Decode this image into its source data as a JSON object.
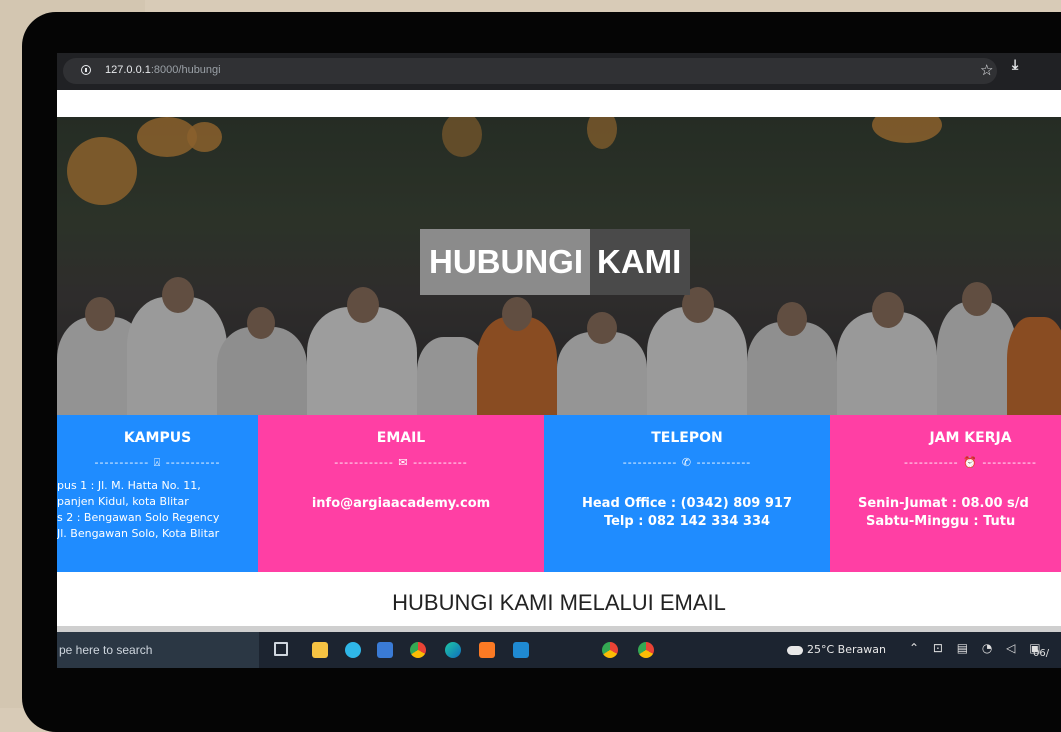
{
  "browser": {
    "url_host": "127.0.0.1",
    "url_path": ":8000/hubungi"
  },
  "hero": {
    "title_word1": "HUBUNGI",
    "title_word2": "KAMI"
  },
  "cards": [
    {
      "title": "KAMPUS",
      "separator": "----------- ⍓ -----------",
      "lines": [
        "pus 1 : Jl. M. Hatta No. 11,",
        "panjen Kidul, kota Blitar",
        "s 2 : Bengawan Solo Regency",
        "Jl. Bengawan Solo, Kota Blitar"
      ],
      "color": "#1f8cff"
    },
    {
      "title": "EMAIL",
      "separator": "------------ ✉ -----------",
      "lines": [
        "info@argiaacademy.com"
      ],
      "color": "#ff3fa4"
    },
    {
      "title": "TELEPON",
      "separator": "----------- ✆ -----------",
      "lines": [
        "Head Office : (0342) 809 917",
        "Telp : 082 142 334 334"
      ],
      "color": "#1f8cff"
    },
    {
      "title": "JAM KERJA",
      "separator": "----------- ⏰ -----------",
      "lines": [
        "Senin-Jumat : 08.00 s/d",
        "Sabtu-Minggu : Tutu"
      ],
      "color": "#ff3fa4"
    }
  ],
  "section": {
    "title": "HUBUNGI KAMI MELALUI EMAIL"
  },
  "taskbar": {
    "search_text": "pe here to search",
    "weather": "25°C  Berawan",
    "clock": "06/"
  }
}
